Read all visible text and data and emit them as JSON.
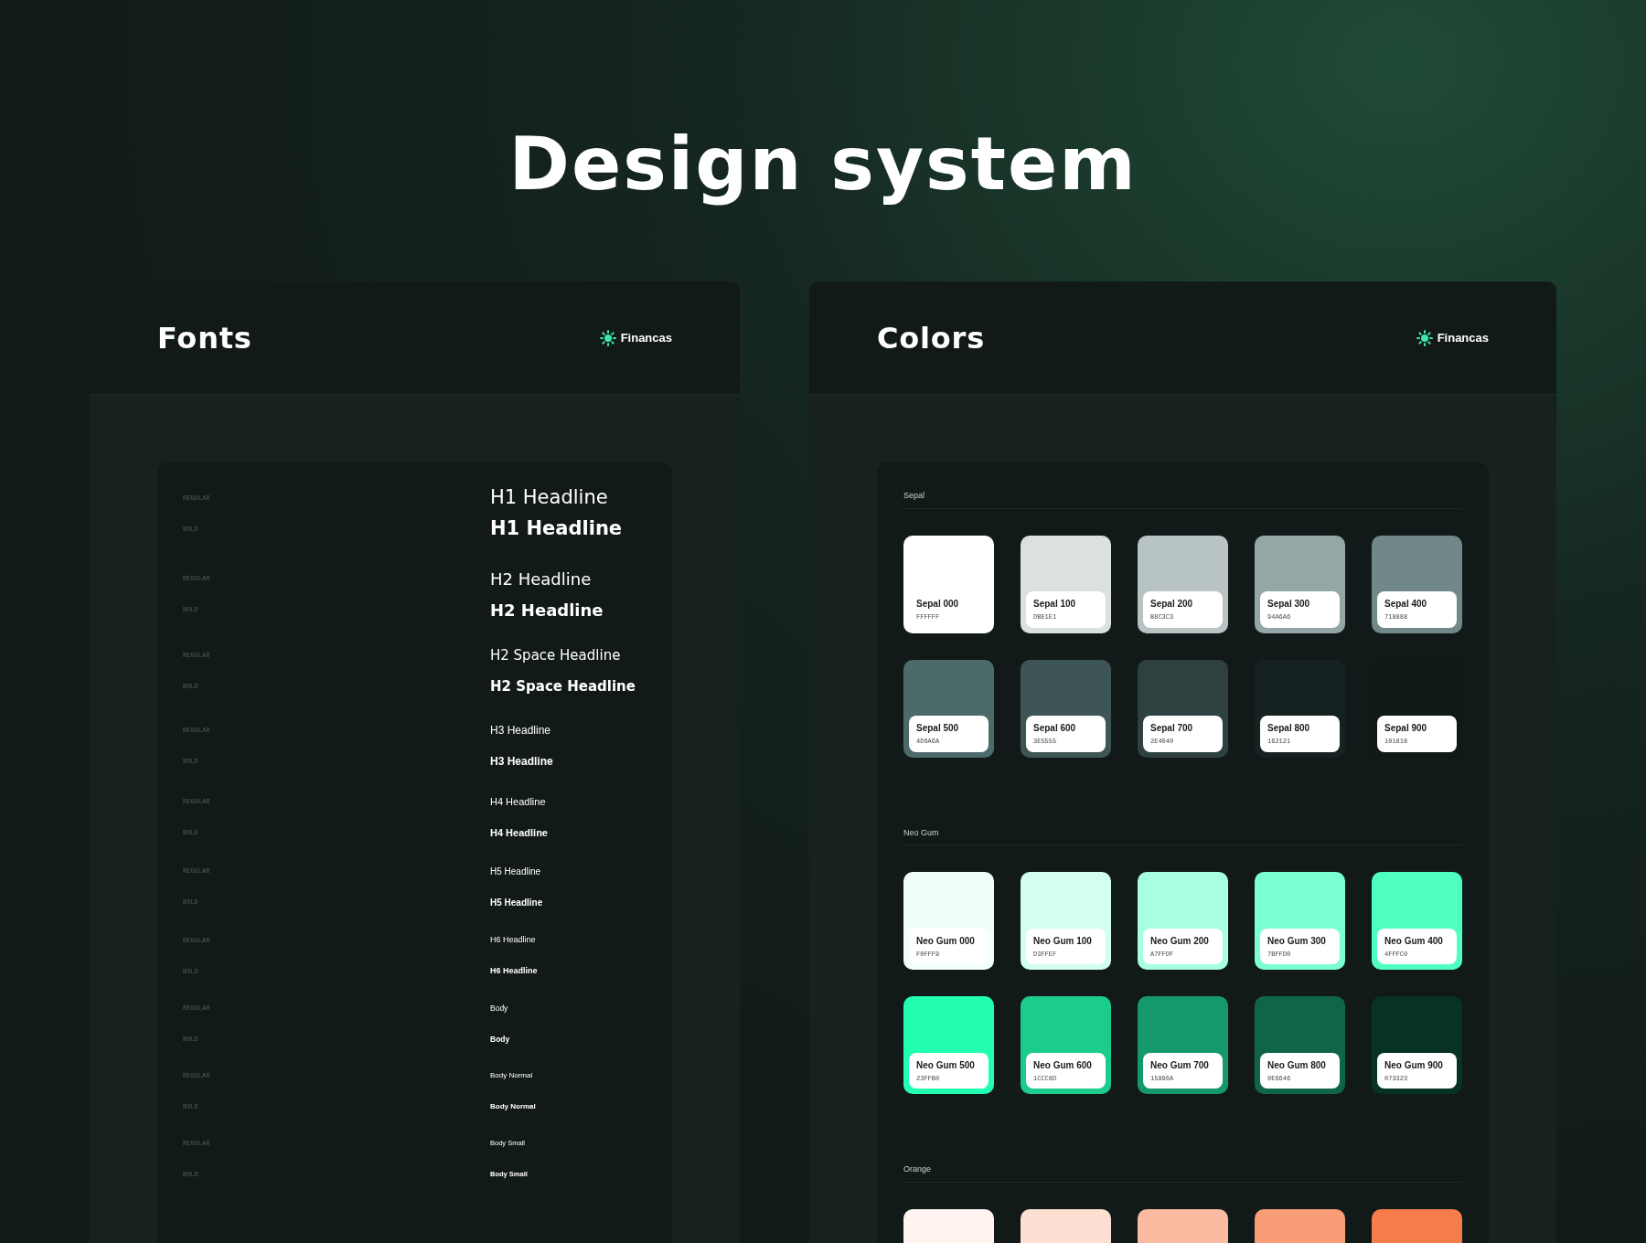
{
  "title": "Design system",
  "fonts_panel": {
    "title": "Fonts",
    "brand": "Financas",
    "groups": [
      {
        "entries": [
          {
            "kind": "regular",
            "label": "REGULAR",
            "sample": "H1 Headline"
          },
          {
            "kind": "bold",
            "label": "BOLD",
            "sample": "H1 Headline"
          }
        ]
      },
      {
        "entries": [
          {
            "kind": "regular",
            "label": "REGULAR",
            "sample": "H2 Headline"
          },
          {
            "kind": "bold",
            "label": "BOLD",
            "sample": "H2 Headline"
          }
        ]
      },
      {
        "entries": [
          {
            "kind": "regular",
            "label": "REGULAR",
            "sample": "H2 Space Headline"
          },
          {
            "kind": "bold",
            "label": "BOLD",
            "sample": "H2 Space Headline"
          }
        ]
      },
      {
        "entries": [
          {
            "kind": "regular",
            "label": "REGULAR",
            "sample": "H3 Headline"
          },
          {
            "kind": "bold",
            "label": "BOLD",
            "sample": "H3 Headline"
          }
        ]
      },
      {
        "entries": [
          {
            "kind": "regular",
            "label": "REGULAR",
            "sample": "H4 Headline"
          },
          {
            "kind": "bold",
            "label": "BOLD",
            "sample": "H4 Headline"
          }
        ]
      },
      {
        "entries": [
          {
            "kind": "regular",
            "label": "REGULAR",
            "sample": "H5 Headline"
          },
          {
            "kind": "bold",
            "label": "BOLD",
            "sample": "H5 Headline"
          }
        ]
      },
      {
        "entries": [
          {
            "kind": "regular",
            "label": "REGULAR",
            "sample": "H6 Headline"
          },
          {
            "kind": "bold",
            "label": "BOLD",
            "sample": "H6 Headline"
          }
        ]
      },
      {
        "entries": [
          {
            "kind": "regular",
            "label": "REGULAR",
            "sample": "Body"
          },
          {
            "kind": "bold",
            "label": "BOLD",
            "sample": "Body"
          }
        ]
      },
      {
        "entries": [
          {
            "kind": "regular",
            "label": "REGULAR",
            "sample": "Body Normal"
          },
          {
            "kind": "bold",
            "label": "BOLD",
            "sample": "Body Normal"
          }
        ]
      },
      {
        "entries": [
          {
            "kind": "regular",
            "label": "REGULAR",
            "sample": "Body Small"
          },
          {
            "kind": "bold",
            "label": "BOLD",
            "sample": "Body Small"
          }
        ]
      }
    ]
  },
  "colors_panel": {
    "title": "Colors",
    "brand": "Financas",
    "palettes": [
      {
        "name": "Sepal",
        "swatches": [
          {
            "name": "Sepal 000",
            "hex": "FFFFFF",
            "color": "#ffffff"
          },
          {
            "name": "Sepal 100",
            "hex": "DBE1E1",
            "color": "#dbe1e1"
          },
          {
            "name": "Sepal 200",
            "hex": "B8C3C3",
            "color": "#b8c3c3"
          },
          {
            "name": "Sepal 300",
            "hex": "94A6A6",
            "color": "#94a6a6"
          },
          {
            "name": "Sepal 400",
            "hex": "718888",
            "color": "#718888"
          },
          {
            "name": "Sepal 500",
            "hex": "4D6A6A",
            "color": "#4d6a6a"
          },
          {
            "name": "Sepal 600",
            "hex": "3E5555",
            "color": "#3e5555"
          },
          {
            "name": "Sepal 700",
            "hex": "2E4040",
            "color": "#2e4040"
          },
          {
            "name": "Sepal 800",
            "hex": "162121",
            "color": "#162121"
          },
          {
            "name": "Sepal 900",
            "hex": "101818",
            "color": "#101818"
          }
        ]
      },
      {
        "name": "Neo Gum",
        "swatches": [
          {
            "name": "Neo Gum 000",
            "hex": "F0FFF9",
            "color": "#f0fff9"
          },
          {
            "name": "Neo Gum 100",
            "hex": "D3FFEF",
            "color": "#d3ffef"
          },
          {
            "name": "Neo Gum 200",
            "hex": "A7FFDF",
            "color": "#a7ffdf"
          },
          {
            "name": "Neo Gum 300",
            "hex": "7BFFD0",
            "color": "#7bffd0"
          },
          {
            "name": "Neo Gum 400",
            "hex": "4FFFC0",
            "color": "#4fffc0"
          },
          {
            "name": "Neo Gum 500",
            "hex": "23FFB0",
            "color": "#23ffb0"
          },
          {
            "name": "Neo Gum 600",
            "hex": "1CCC8D",
            "color": "#1ccc8d"
          },
          {
            "name": "Neo Gum 700",
            "hex": "15996A",
            "color": "#15996a"
          },
          {
            "name": "Neo Gum 800",
            "hex": "0E6646",
            "color": "#0e6646"
          },
          {
            "name": "Neo Gum 900",
            "hex": "073323",
            "color": "#073323"
          }
        ]
      },
      {
        "name": "Orange",
        "swatches": [
          {
            "color": "#fff4f0"
          },
          {
            "color": "#fde0d2"
          },
          {
            "color": "#fbbba0"
          },
          {
            "color": "#f99c78"
          },
          {
            "color": "#f77c4b"
          }
        ]
      }
    ]
  }
}
